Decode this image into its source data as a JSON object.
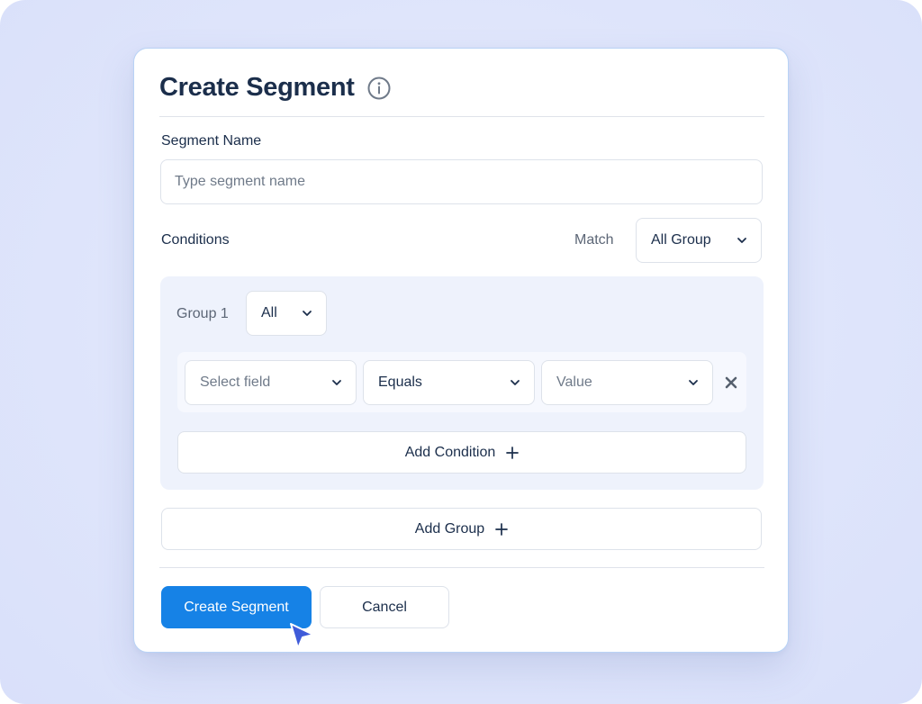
{
  "dialog": {
    "title": "Create Segment",
    "info_icon": "info-icon"
  },
  "segment_name": {
    "label": "Segment Name",
    "placeholder": "Type segment name",
    "value": ""
  },
  "conditions": {
    "label": "Conditions",
    "match_label": "Match",
    "match_value": "All Group"
  },
  "groups": [
    {
      "label": "Group 1",
      "mode": "All",
      "condition": {
        "field_placeholder": "Select field",
        "operator": "Equals",
        "value_placeholder": "Value",
        "remove_icon": "close-icon"
      },
      "add_condition_label": "Add Condition"
    }
  ],
  "add_group_label": "Add Group",
  "footer": {
    "primary_label": "Create Segment",
    "cancel_label": "Cancel"
  },
  "colors": {
    "accent": "#1682e6",
    "text": "#1b2e4b",
    "muted": "#5c6676",
    "group_bg": "#eef2fc",
    "cursor": "#3f5bd9"
  }
}
